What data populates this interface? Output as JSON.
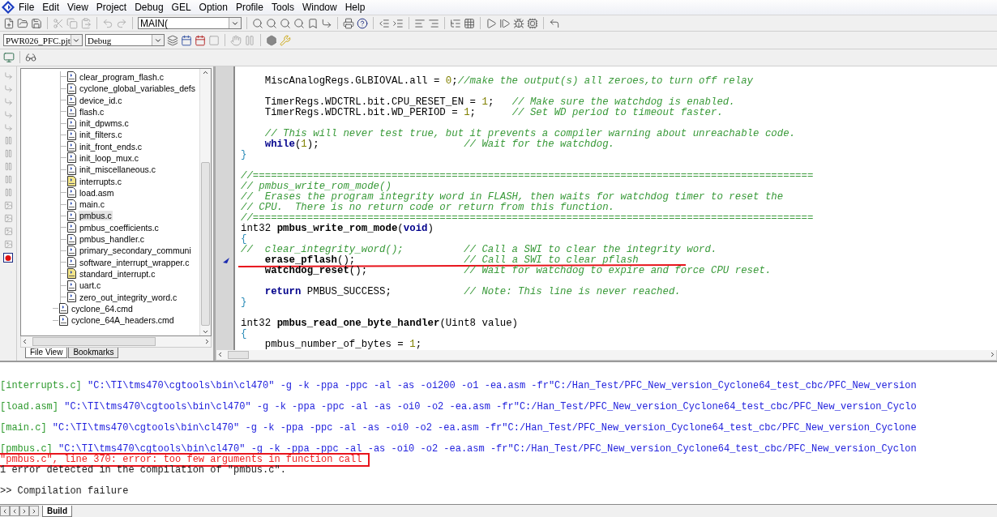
{
  "menu": [
    "File",
    "Edit",
    "View",
    "Project",
    "Debug",
    "GEL",
    "Option",
    "Profile",
    "Tools",
    "Window",
    "Help"
  ],
  "toolbar": {
    "function_combo": "MAIN(",
    "project_combo": "PWR026_PFC.pjt",
    "config_combo": "Debug"
  },
  "file_tree": {
    "items": [
      {
        "children": [
          {
            "label": "clear_program_flash.c",
            "selected": false,
            "highlighted": false
          },
          {
            "label": "cyclone_global_variables_defs",
            "selected": false,
            "highlighted": false
          },
          {
            "label": "device_id.c",
            "selected": false,
            "highlighted": false
          },
          {
            "label": "flash.c",
            "selected": false,
            "highlighted": false
          },
          {
            "label": "init_dpwms.c",
            "selected": false,
            "highlighted": false
          },
          {
            "label": "init_filters.c",
            "selected": false,
            "highlighted": false
          },
          {
            "label": "init_front_ends.c",
            "selected": false,
            "highlighted": false
          },
          {
            "label": "init_loop_mux.c",
            "selected": false,
            "highlighted": false
          },
          {
            "label": "init_miscellaneous.c",
            "selected": false,
            "highlighted": false
          },
          {
            "label": "interrupts.c",
            "selected": false,
            "highlighted": true
          },
          {
            "label": "load.asm",
            "selected": false,
            "highlighted": false
          },
          {
            "label": "main.c",
            "selected": false,
            "highlighted": false
          },
          {
            "label": "pmbus.c",
            "selected": true,
            "highlighted": false
          },
          {
            "label": "pmbus_coefficients.c",
            "selected": false,
            "highlighted": false
          },
          {
            "label": "pmbus_handler.c",
            "selected": false,
            "highlighted": false
          },
          {
            "label": "primary_secondary_communi",
            "selected": false,
            "highlighted": false
          },
          {
            "label": "software_interrupt_wrapper.c",
            "selected": false,
            "highlighted": false
          },
          {
            "label": "standard_interrupt.c",
            "selected": false,
            "highlighted": true
          },
          {
            "label": "uart.c",
            "selected": false,
            "highlighted": false
          },
          {
            "label": "zero_out_integrity_word.c",
            "selected": false,
            "highlighted": false
          }
        ]
      },
      {
        "label": "cyclone_64.cmd",
        "selected": false,
        "highlighted": false
      },
      {
        "label": "cyclone_64A_headers.cmd",
        "selected": false,
        "highlighted": false
      }
    ],
    "tabs": [
      {
        "label": "File View",
        "selected": true
      },
      {
        "label": "Bookmarks",
        "selected": false
      }
    ]
  },
  "editor": {
    "lines": [
      {
        "kind": "code",
        "bookmarked": false,
        "underlined": false,
        "segments": [
          {
            "text": "    MiscAnalogRegs.GLBIOVAL.all = ",
            "kind": "plain"
          },
          {
            "text": "0",
            "kind": "number"
          },
          {
            "text": ";",
            "kind": "plain"
          },
          {
            "text": "//make the output(s) all zeroes,to turn off relay",
            "kind": "comment"
          }
        ]
      },
      {
        "kind": "blank"
      },
      {
        "kind": "code",
        "bookmarked": false,
        "underlined": false,
        "segments": [
          {
            "text": "    TimerRegs.WDCTRL.bit.CPU_RESET_EN = ",
            "kind": "plain"
          },
          {
            "text": "1",
            "kind": "number"
          },
          {
            "text": ";   ",
            "kind": "plain"
          },
          {
            "text": "// Make sure the watchdog is enabled.",
            "kind": "comment"
          }
        ]
      },
      {
        "kind": "code",
        "bookmarked": false,
        "underlined": false,
        "segments": [
          {
            "text": "    TimerRegs.WDCTRL.bit.WD_PERIOD = ",
            "kind": "plain"
          },
          {
            "text": "1",
            "kind": "number"
          },
          {
            "text": ";      ",
            "kind": "plain"
          },
          {
            "text": "// Set WD period to timeout faster.",
            "kind": "comment"
          }
        ]
      },
      {
        "kind": "blank"
      },
      {
        "kind": "code",
        "bookmarked": false,
        "underlined": false,
        "segments": [
          {
            "text": "    // This will never test true, but it prevents a compiler warning about unreachable code.",
            "kind": "comment"
          }
        ]
      },
      {
        "kind": "code",
        "bookmarked": false,
        "underlined": false,
        "segments": [
          {
            "text": "    while",
            "kind": "keyword"
          },
          {
            "text": "(",
            "kind": "plain"
          },
          {
            "text": "1",
            "kind": "number"
          },
          {
            "text": ");                        ",
            "kind": "plain"
          },
          {
            "text": "// Wait for the watchdog.",
            "kind": "comment"
          }
        ]
      },
      {
        "kind": "code",
        "bookmarked": false,
        "underlined": false,
        "segments": [
          {
            "text": "}",
            "kind": "brace"
          }
        ]
      },
      {
        "kind": "blank"
      },
      {
        "kind": "code",
        "bookmarked": false,
        "underlined": false,
        "segments": [
          {
            "text": "//=============================================================================================",
            "kind": "comment"
          }
        ]
      },
      {
        "kind": "code",
        "bookmarked": false,
        "underlined": false,
        "segments": [
          {
            "text": "// pmbus_write_rom_mode()",
            "kind": "comment"
          }
        ]
      },
      {
        "kind": "code",
        "bookmarked": false,
        "underlined": false,
        "segments": [
          {
            "text": "//  Erases the program integrity word in FLASH, then waits for watchdog timer to reset the",
            "kind": "comment"
          }
        ]
      },
      {
        "kind": "code",
        "bookmarked": false,
        "underlined": false,
        "segments": [
          {
            "text": "// CPU.  There is no return code or return from this function.",
            "kind": "comment"
          }
        ]
      },
      {
        "kind": "code",
        "bookmarked": false,
        "underlined": false,
        "segments": [
          {
            "text": "//=============================================================================================",
            "kind": "comment"
          }
        ]
      },
      {
        "kind": "code",
        "bookmarked": false,
        "underlined": false,
        "segments": [
          {
            "text": "int32 ",
            "kind": "plain"
          },
          {
            "text": "pmbus_write_rom_mode",
            "kind": "function"
          },
          {
            "text": "(",
            "kind": "plain"
          },
          {
            "text": "void",
            "kind": "keyword"
          },
          {
            "text": ")",
            "kind": "plain"
          }
        ]
      },
      {
        "kind": "code",
        "bookmarked": false,
        "underlined": false,
        "segments": [
          {
            "text": "{",
            "kind": "brace"
          }
        ]
      },
      {
        "kind": "code",
        "bookmarked": false,
        "underlined": false,
        "segments": [
          {
            "text": "//  clear_integrity_word();          // Call a SWI to clear the integrity word.",
            "kind": "comment"
          }
        ]
      },
      {
        "kind": "code",
        "bookmarked": true,
        "underlined": true,
        "segments": [
          {
            "text": "    erase_pflash",
            "kind": "function"
          },
          {
            "text": "();                  ",
            "kind": "plain"
          },
          {
            "text": "// Call a SWI to clear pflash",
            "kind": "comment"
          }
        ]
      },
      {
        "kind": "code",
        "bookmarked": false,
        "underlined": false,
        "segments": [
          {
            "text": "    watchdog_reset",
            "kind": "function"
          },
          {
            "text": "();                ",
            "kind": "plain"
          },
          {
            "text": "// Wait for watchdog to expire and force CPU reset.",
            "kind": "comment"
          }
        ]
      },
      {
        "kind": "blank"
      },
      {
        "kind": "code",
        "bookmarked": false,
        "underlined": false,
        "segments": [
          {
            "text": "    return",
            "kind": "keyword"
          },
          {
            "text": " PMBUS_SUCCESS;            ",
            "kind": "plain"
          },
          {
            "text": "// Note: This line is never reached.",
            "kind": "comment"
          }
        ]
      },
      {
        "kind": "code",
        "bookmarked": false,
        "underlined": false,
        "segments": [
          {
            "text": "}",
            "kind": "brace"
          }
        ]
      },
      {
        "kind": "blank"
      },
      {
        "kind": "code",
        "bookmarked": false,
        "underlined": false,
        "segments": [
          {
            "text": "int32 ",
            "kind": "plain"
          },
          {
            "text": "pmbus_read_one_byte_handler",
            "kind": "function"
          },
          {
            "text": "(Uint8 value)",
            "kind": "plain"
          }
        ]
      },
      {
        "kind": "code",
        "bookmarked": false,
        "underlined": false,
        "segments": [
          {
            "text": "{",
            "kind": "brace"
          }
        ]
      },
      {
        "kind": "code",
        "bookmarked": false,
        "underlined": false,
        "segments": [
          {
            "text": "    pmbus_number_of_bytes = ",
            "kind": "plain"
          },
          {
            "text": "1",
            "kind": "number"
          },
          {
            "text": ";",
            "kind": "plain"
          }
        ]
      }
    ]
  },
  "output": {
    "lines": [
      {
        "kind": "blank"
      },
      {
        "kind": "command",
        "file": "[interrupts.c]",
        "command": " \"C:\\TI\\tms470\\cgtools\\bin\\cl470\" -g -k -ppa -ppc -al -as -oi200 -o1 -ea.asm -fr\"C:/Han_Test/PFC_New_version_Cyclone64_test_cbc/PFC_New_version"
      },
      {
        "kind": "blank"
      },
      {
        "kind": "command",
        "file": "[load.asm]",
        "command": " \"C:\\TI\\tms470\\cgtools\\bin\\cl470\" -g -k -ppa -ppc -al -as -oi0 -o2 -ea.asm -fr\"C:/Han_Test/PFC_New_version_Cyclone64_test_cbc/PFC_New_version_Cyclo"
      },
      {
        "kind": "blank"
      },
      {
        "kind": "command",
        "file": "[main.c]",
        "command": " \"C:\\TI\\tms470\\cgtools\\bin\\cl470\" -g -k -ppa -ppc -al -as -oi0 -o2 -ea.asm -fr\"C:/Han_Test/PFC_New_version_Cyclone64_test_cbc/PFC_New_version_Cyclone"
      },
      {
        "kind": "blank"
      },
      {
        "kind": "command",
        "file": "[pmbus.c]",
        "command": " \"C:\\TI\\tms470\\cgtools\\bin\\cl470\" -g -k -ppa -ppc -al -as -oi0 -o2 -ea.asm -fr\"C:/Han_Test/PFC_New_version_Cyclone64_test_cbc/PFC_New_version_Cyclon"
      },
      {
        "kind": "error",
        "text": "\"pmbus.c\", line 370: error: too few arguments in function call",
        "boxed": true
      },
      {
        "kind": "message",
        "text": "1 error detected in the compilation of \"pmbus.c\"."
      },
      {
        "kind": "blank"
      },
      {
        "kind": "message",
        "text": ">> Compilation failure"
      }
    ],
    "tabs": [
      {
        "label": "Build",
        "selected": true
      }
    ]
  }
}
